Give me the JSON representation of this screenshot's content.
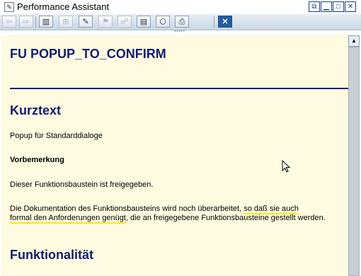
{
  "window": {
    "title": "Performance Assistant"
  },
  "titlebar_controls": [
    {
      "name": "restore-icon"
    },
    {
      "name": "minimize-icon"
    },
    {
      "name": "maximize-icon"
    },
    {
      "name": "close-icon"
    }
  ],
  "toolbar": {
    "buttons": [
      {
        "name": "back-arrow-icon",
        "glyph": "⇦",
        "enabled": false
      },
      {
        "name": "forward-arrow-icon",
        "glyph": "⇨",
        "enabled": false
      },
      {
        "name": "book-icon",
        "glyph": "▥",
        "enabled": true
      },
      {
        "name": "hierarchy-icon",
        "glyph": "⊞",
        "enabled": false
      },
      {
        "name": "edit-note-icon",
        "glyph": "✎",
        "enabled": true
      },
      {
        "name": "bookmark-icon",
        "glyph": "⚑",
        "enabled": false
      },
      {
        "name": "network-icon",
        "glyph": "☍",
        "enabled": false
      },
      {
        "name": "list-icon",
        "glyph": "▤",
        "enabled": true
      },
      {
        "name": "tag-icon",
        "glyph": "⬡",
        "enabled": true
      },
      {
        "name": "print-icon",
        "glyph": "⎙",
        "enabled": true
      },
      {
        "name": "close-window-icon",
        "glyph": "✕",
        "enabled": true
      }
    ]
  },
  "document": {
    "heading": "FU POPUP_TO_CONFIRM",
    "section_kurztext": "Kurztext",
    "kurztext_text": "Popup für Standarddialoge",
    "vorbemerkung_label": "Vorbemerkung",
    "vorbemerkung_text": "Dieser Funktionsbaustein ist freigegeben.",
    "doc_note": {
      "part1": "Die Dokumentation des Funktionsbausteins wird noch überarbeitet, ",
      "highlight1": "so daß sie auch",
      "highlight2": "formal den Anforderungen genügt",
      "part3": ", die an freigegebene Funktionsbausteine gestellt werden."
    },
    "section_funktionalitaet": "Funktionalität"
  },
  "colors": {
    "background": "#fffbe0",
    "heading": "#111d74",
    "highlight": "#ffea00"
  }
}
